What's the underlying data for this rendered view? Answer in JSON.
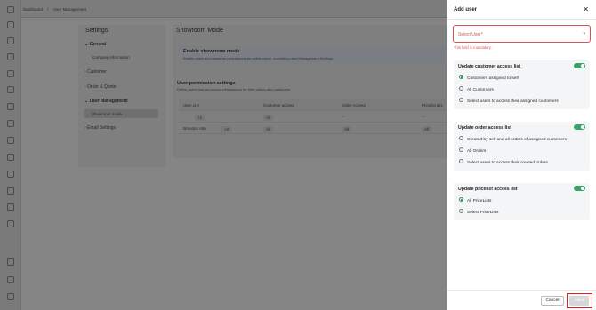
{
  "breadcrumb": [
    "Dashboard",
    "/",
    "User Management"
  ],
  "settings": {
    "title": "Settings",
    "general": "General",
    "company_info": "Company information",
    "customer": "Customer",
    "order_quote": "Order & Quote",
    "user_mgmt": "User Management",
    "showroom": "Showroom mode",
    "email": "Email Settings"
  },
  "main": {
    "title": "Showroom Mode",
    "banner_title": "Enable showroom mode",
    "banner_desc": "Enable order and customer permissions for active users, overriding User Management Settings",
    "perm_title": "User permission settings",
    "perm_desc": "Define users and set access permissions for their orders and customers.",
    "columns": [
      "User List",
      "Customer access",
      "Order Access",
      "Pricelist acc"
    ],
    "rows": [
      {
        "user": "",
        "badge": "+1",
        "customer": "All",
        "order": "--",
        "pricelist": "--"
      },
      {
        "user": "Brandon Atte",
        "badge": "+2",
        "customer": "All",
        "order": "All",
        "pricelist": "All"
      }
    ]
  },
  "panel": {
    "title": "Add user",
    "select_placeholder": "Select User*",
    "error": "This field is mandatory.",
    "customer": {
      "title": "Update customer access list",
      "options": [
        "Customers assigned to self",
        "All Customers",
        "Select users to access their assigned customers"
      ],
      "selected": 0
    },
    "order": {
      "title": "Update order access list",
      "options": [
        "Created by self and all orders of assigned customers",
        "All Orders",
        "Select users to access their created orders"
      ],
      "selected": -1
    },
    "pricelist": {
      "title": "Update pricelist access list",
      "options": [
        "All PriceLists",
        "Select PriceLists"
      ],
      "selected": 0
    },
    "cancel": "Cancel",
    "save": "Save"
  },
  "colors": {
    "accent": "#3aa36a",
    "error": "#d9534f",
    "highlight": "#e02020"
  }
}
